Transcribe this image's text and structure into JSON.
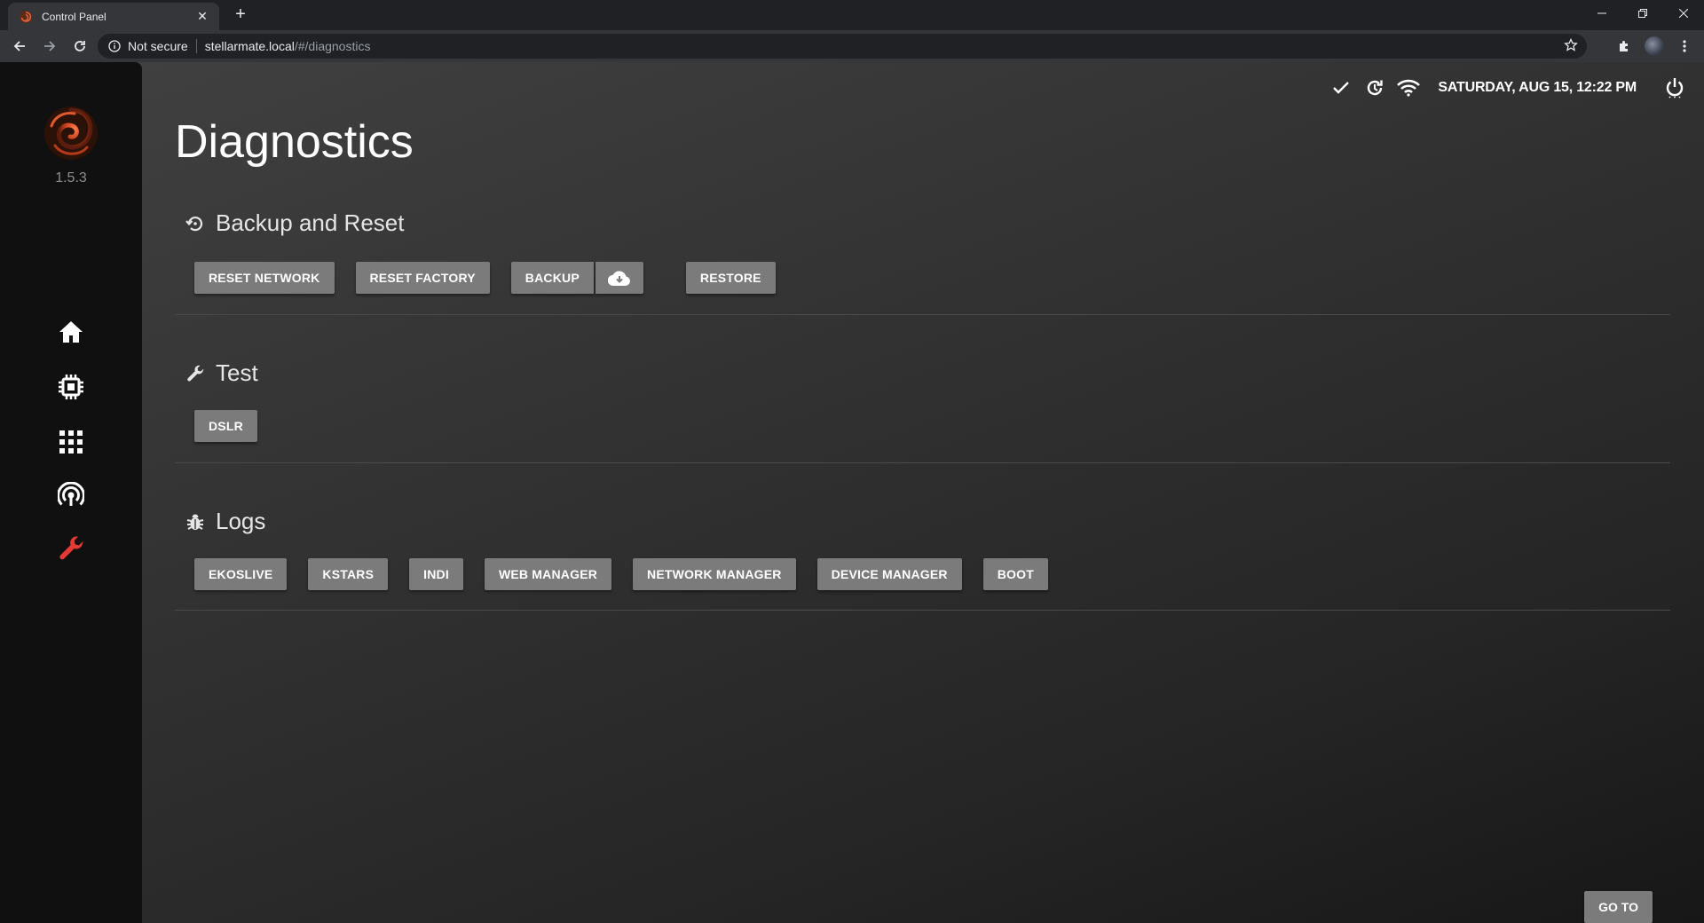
{
  "browser": {
    "tab_title": "Control Panel",
    "new_tab_symbol": "+",
    "omnibox": {
      "security_label": "Not secure",
      "host": "stellarmate.local",
      "path": "/#/diagnostics"
    }
  },
  "sidebar": {
    "version": "1.5.3",
    "items": [
      {
        "id": "home",
        "icon": "home-icon"
      },
      {
        "id": "devices",
        "icon": "chip-icon"
      },
      {
        "id": "apps",
        "icon": "grid-icon"
      },
      {
        "id": "network",
        "icon": "hotspot-icon"
      },
      {
        "id": "diagnostics",
        "icon": "wrench-icon",
        "active": true
      }
    ],
    "active_color": "#e53935"
  },
  "topbar": {
    "datetime": "SATURDAY, AUG 15, 12:22 PM",
    "icons": [
      "check-icon",
      "update-icon",
      "wifi-icon",
      "power-icon"
    ]
  },
  "page": {
    "title": "Diagnostics"
  },
  "sections": {
    "backup": {
      "title": "Backup and Reset",
      "icon": "restore-icon",
      "buttons": {
        "reset_network": "RESET NETWORK",
        "reset_factory": "RESET FACTORY",
        "backup": "BACKUP",
        "restore": "RESTORE"
      }
    },
    "test": {
      "title": "Test",
      "icon": "wrench-icon",
      "buttons": {
        "dslr": "DSLR"
      }
    },
    "logs": {
      "title": "Logs",
      "icon": "bug-icon",
      "buttons": {
        "ekoslive": "EKOSLIVE",
        "kstars": "KSTARS",
        "indi": "INDI",
        "web_manager": "WEB MANAGER",
        "network_manager": "NETWORK MANAGER",
        "device_manager": "DEVICE MANAGER",
        "boot": "BOOT"
      }
    }
  },
  "goto_label": "GO TO",
  "colors": {
    "button_bg": "#7b7b7b",
    "sidebar_bg": "#101010",
    "accent": "#e53935"
  }
}
